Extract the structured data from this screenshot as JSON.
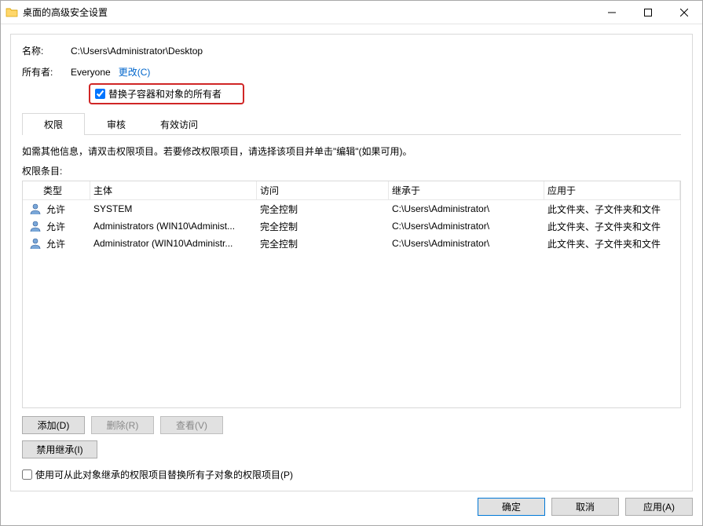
{
  "window": {
    "title": "桌面的高级安全设置"
  },
  "fields": {
    "name_label": "名称:",
    "name_value": "C:\\Users\\Administrator\\Desktop",
    "owner_label": "所有者:",
    "owner_value": "Everyone",
    "change_link": "更改(C)",
    "replace_owner_checkbox": "替换子容器和对象的所有者"
  },
  "tabs": {
    "permissions": "权限",
    "audit": "审核",
    "effective": "有效访问"
  },
  "info_text": "如需其他信息，请双击权限项目。若要修改权限项目，请选择该项目并单击\"编辑\"(如果可用)。",
  "section_label": "权限条目:",
  "columns": {
    "type": "类型",
    "principal": "主体",
    "access": "访问",
    "inherited_from": "继承于",
    "applies_to": "应用于"
  },
  "entries": [
    {
      "type": "允许",
      "principal": "SYSTEM",
      "access": "完全控制",
      "inherited_from": "C:\\Users\\Administrator\\",
      "applies_to": "此文件夹、子文件夹和文件"
    },
    {
      "type": "允许",
      "principal": "Administrators (WIN10\\Administ...",
      "access": "完全控制",
      "inherited_from": "C:\\Users\\Administrator\\",
      "applies_to": "此文件夹、子文件夹和文件"
    },
    {
      "type": "允许",
      "principal": "Administrator (WIN10\\Administr...",
      "access": "完全控制",
      "inherited_from": "C:\\Users\\Administrator\\",
      "applies_to": "此文件夹、子文件夹和文件"
    }
  ],
  "buttons": {
    "add": "添加(D)",
    "remove": "删除(R)",
    "view": "查看(V)",
    "disable_inherit": "禁用继承(I)",
    "replace_child_permissions": "使用可从此对象继承的权限项目替换所有子对象的权限项目(P)",
    "ok": "确定",
    "cancel": "取消",
    "apply": "应用(A)"
  }
}
